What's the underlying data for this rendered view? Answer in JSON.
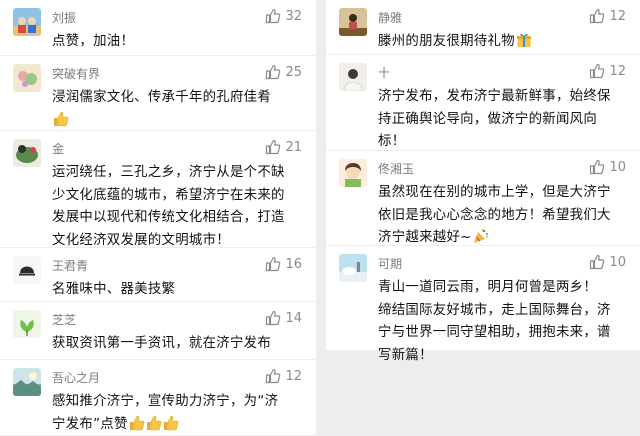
{
  "colors": {
    "background": "#ededed",
    "card": "#ffffff",
    "like_icon": "#8a8a8a"
  },
  "left_comments": [
    {
      "name": "刘振",
      "likes": "32",
      "lines": [
        "点赞，加油！"
      ]
    },
    {
      "name": "突破有界",
      "likes": "25",
      "lines": [
        "浸润儒家文化、传承千年的孔府佳肴"
      ],
      "emoji": "thumbs-up"
    },
    {
      "name": "金",
      "likes": "21",
      "lines": [
        "运河绕任，三孔之乡，济宁从是个不缺",
        "少文化底蕴的城市，希望济宁在未来的",
        "发展中以现代和传统文化相结合，打造",
        "文化经济双发展的文明城市！"
      ]
    },
    {
      "name": "王君青",
      "likes": "16",
      "lines": [
        "名雅味中、器美技繁"
      ]
    },
    {
      "name": "芝芝",
      "likes": "14",
      "lines": [
        "获取资讯第一手资讯，就在济宁发布"
      ]
    },
    {
      "name": "吾心之月",
      "likes": "12",
      "lines": [
        "感知推介济宁，宣传助力济宁，为“济",
        "宁发布”点赞"
      ],
      "emoji": "thumbs-up"
    }
  ],
  "right_comments": [
    {
      "name": "静雅",
      "likes": "12",
      "lines": [
        "滕州的朋友很期待礼物"
      ],
      "emoji": "gift"
    },
    {
      "name": "十",
      "likes": "12",
      "lines": [
        "济宁发布，发布济宁最新鲜事，始终保",
        "持正确舆论导向，做济宁的新闻风向",
        "标！"
      ]
    },
    {
      "name": "佟湘玉",
      "likes": "10",
      "lines": [
        "虽然现在在别的城市上学，但是大济宁",
        "依旧是我心心念念的地方！希望我们大",
        "济宁越来越好~"
      ],
      "emoji": "party-popper"
    },
    {
      "name": "可期",
      "likes": "10",
      "lines": [
        "青山一道同云雨，明月何曾是两乡！",
        "缔结国际友好城市，走上国际舞台，济",
        "宁与世界一同守望相助，拥抱未来，谱",
        "写新篇！"
      ]
    }
  ]
}
